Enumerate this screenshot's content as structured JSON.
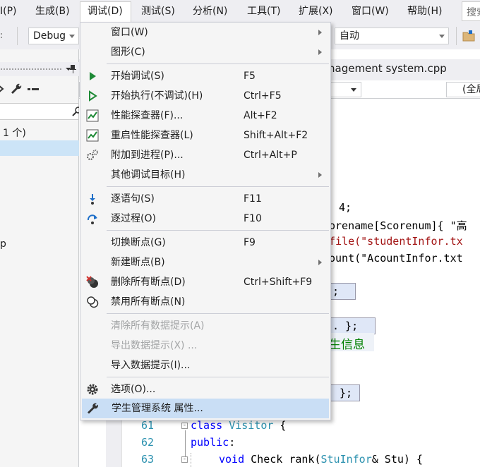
{
  "menubar": {
    "items": [
      {
        "label": "I(P)"
      },
      {
        "label": "生成(B)"
      },
      {
        "label": "调试(D)"
      },
      {
        "label": "测试(S)"
      },
      {
        "label": "分析(N)"
      },
      {
        "label": "工具(T)"
      },
      {
        "label": "扩展(X)"
      },
      {
        "label": "窗口(W)"
      },
      {
        "label": "帮助(H)"
      }
    ],
    "search_label": "搜索"
  },
  "toolbar": {
    "config_value": "Debug",
    "auto_value": "自动"
  },
  "left_panel": {
    "count_text": "1 个)",
    "letter": "p"
  },
  "editor": {
    "tab_title": "nagement system.cpp",
    "scope_value": "(全局",
    "lines": {
      "l1_num": "4;",
      "l2_code": "orename[Scorenum]{ \"高",
      "l3_code": "file(\"studentInfor.tx",
      "l4_code": "ount(\"AcountInfor.txt",
      "box1": ";",
      "box2": ". };",
      "comment": "生信息",
      "box3": "};",
      "ln61": "61",
      "ln62": "62",
      "ln63": "63",
      "c61_kw": "class",
      "c61_ty": "Visitor",
      "c61_rest": " {",
      "c62_kw": "public",
      "c62_rest": ":",
      "c63_kw": "void",
      "c63_name": " Check rank(",
      "c63_ty": "StuInfor",
      "c63_rest": "& Stu) {"
    }
  },
  "menu": {
    "items": [
      {
        "label": "窗口(W)",
        "shortcut": "",
        "submenu": true,
        "icon": "none"
      },
      {
        "label": "图形(C)",
        "shortcut": "",
        "submenu": true,
        "icon": "none"
      },
      {
        "label": "开始调试(S)",
        "shortcut": "F5",
        "icon": "play-filled-icon"
      },
      {
        "label": "开始执行(不调试)(H)",
        "shortcut": "Ctrl+F5",
        "icon": "play-outline-icon"
      },
      {
        "label": "性能探查器(F)...",
        "shortcut": "Alt+F2",
        "icon": "chart-icon"
      },
      {
        "label": "重启性能探查器(L)",
        "shortcut": "Shift+Alt+F2",
        "icon": "chart-icon"
      },
      {
        "label": "附加到进程(P)...",
        "shortcut": "Ctrl+Alt+P",
        "icon": "gears-icon"
      },
      {
        "label": "其他调试目标(H)",
        "shortcut": "",
        "submenu": true,
        "icon": "none"
      },
      {
        "label": "逐语句(S)",
        "shortcut": "F11",
        "icon": "step-into-icon"
      },
      {
        "label": "逐过程(O)",
        "shortcut": "F10",
        "icon": "step-over-icon"
      },
      {
        "label": "切换断点(G)",
        "shortcut": "F9",
        "icon": "none"
      },
      {
        "label": "新建断点(B)",
        "shortcut": "",
        "submenu": true,
        "icon": "none"
      },
      {
        "label": "删除所有断点(D)",
        "shortcut": "Ctrl+Shift+F9",
        "icon": "delete-breakpoints-icon"
      },
      {
        "label": "禁用所有断点(N)",
        "shortcut": "",
        "icon": "disable-breakpoints-icon"
      },
      {
        "label": "清除所有数据提示(A)",
        "shortcut": "",
        "disabled": true,
        "icon": "none"
      },
      {
        "label": "导出数据提示(X) ...",
        "shortcut": "",
        "disabled": true,
        "icon": "none"
      },
      {
        "label": "导入数据提示(I)...",
        "shortcut": "",
        "icon": "none"
      },
      {
        "label": "选项(O)...",
        "shortcut": "",
        "icon": "gear-icon"
      },
      {
        "label": "学生管理系统 属性...",
        "shortcut": "",
        "icon": "wrench-icon",
        "hover": true
      }
    ]
  },
  "colors": {
    "accent": "#c9def5",
    "play_green": "#1e8a36",
    "step_blue": "#1e6fc9"
  }
}
